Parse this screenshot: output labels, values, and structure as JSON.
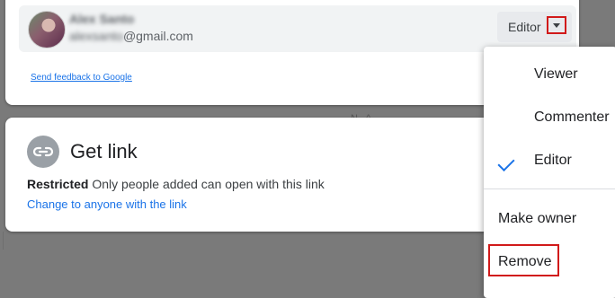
{
  "share_dialog": {
    "person": {
      "name": "Alex Santo",
      "email_hidden": "alexsanto",
      "email_domain": "@gmail.com",
      "role": "Editor",
      "avatar_icon": "user-avatar"
    },
    "feedback_link": "Send feedback to Google"
  },
  "get_link": {
    "title": "Get link",
    "icon": "link-icon",
    "status_strong": "Restricted",
    "status_text": "Only people added can open with this link",
    "change_link": "Change to anyone with the link"
  },
  "role_menu": {
    "items": [
      "Viewer",
      "Commenter",
      "Editor"
    ],
    "selected": "Editor",
    "actions": [
      "Make owner",
      "Remove"
    ]
  },
  "colors": {
    "accent": "#1a73e8",
    "highlight": "#d11a1a",
    "overlay": "#7a7a7a"
  }
}
